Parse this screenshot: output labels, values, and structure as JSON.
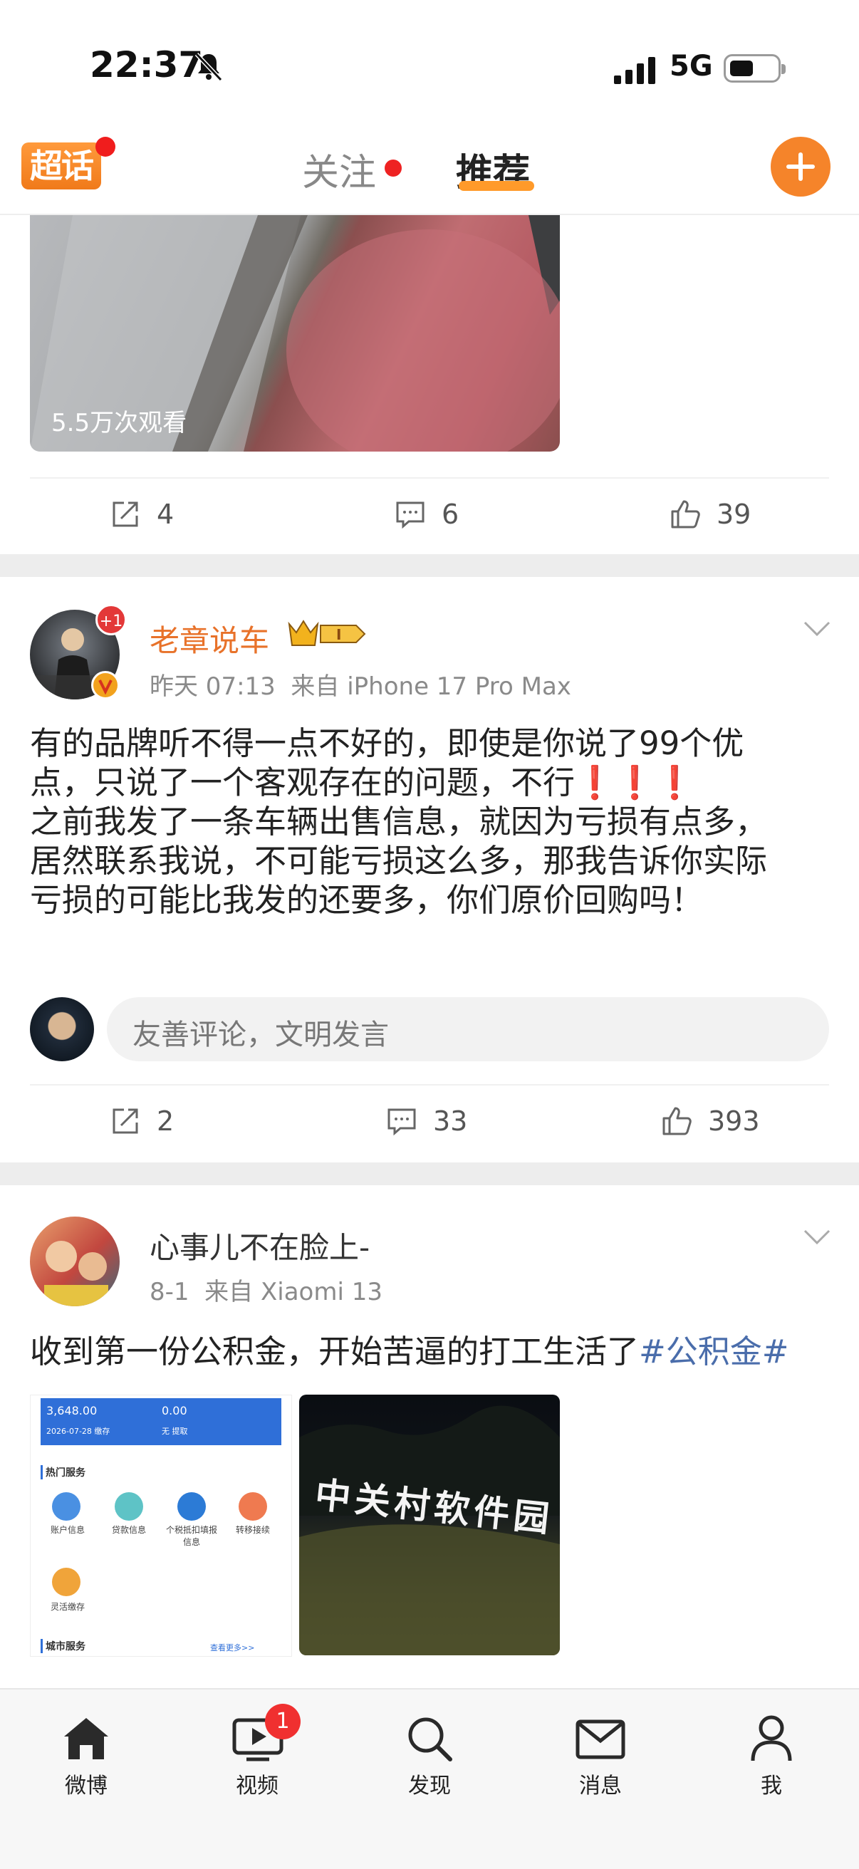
{
  "status_bar": {
    "time": "22:37",
    "network": "5G"
  },
  "header": {
    "logo": "超话",
    "tabs": [
      "关注",
      "推荐"
    ],
    "active_tab": "推荐"
  },
  "post0": {
    "video_views": "5.5万次观看",
    "reposts": "4",
    "comments": "6",
    "likes": "39"
  },
  "post1": {
    "author": "老章说车",
    "badge_plus": "+1",
    "time": "昨天 07:13",
    "source": "来自 iPhone 17 Pro Max",
    "text_lines": [
      "有的品牌听不得一点不好的，即使是你说了99个优",
      "点，只说了一个客观存在的问题，不行❗❗❗",
      "之前我发了一条车辆出售信息，就因为亏损有点多，",
      "居然联系我说，不可能亏损这么多，那我告诉你实际",
      "亏损的可能比我发的还要多，你们原价回购吗！"
    ],
    "comment_placeholder": "友善评论，文明发言",
    "reposts": "2",
    "comments": "33",
    "likes": "393"
  },
  "post2": {
    "author": "心事儿不在脸上-",
    "time": "8-1",
    "source": "来自 Xiaomi 13",
    "text": "收到第一份公积金，开始苦逼的打工生活了",
    "hashtag": "#公积金#",
    "shot": {
      "balance": "3,648.00",
      "amount2": "0.00",
      "date_note": "2026-07-28 缴存",
      "none_note": "无 提取",
      "section1": "热门服务",
      "services": [
        "账户信息",
        "贷款信息",
        "个税抵扣填报信息",
        "转移接续",
        "灵活缴存"
      ],
      "section2": "城市服务",
      "more": "查看更多>>"
    },
    "photo_sign": "中关村软件园"
  },
  "tabbar": {
    "items": [
      "微博",
      "视频",
      "发现",
      "消息",
      "我"
    ],
    "video_badge": "1"
  },
  "colors": {
    "accent": "#f5842a",
    "username_orange": "#e8722a",
    "hashtag": "#4a6dab"
  }
}
